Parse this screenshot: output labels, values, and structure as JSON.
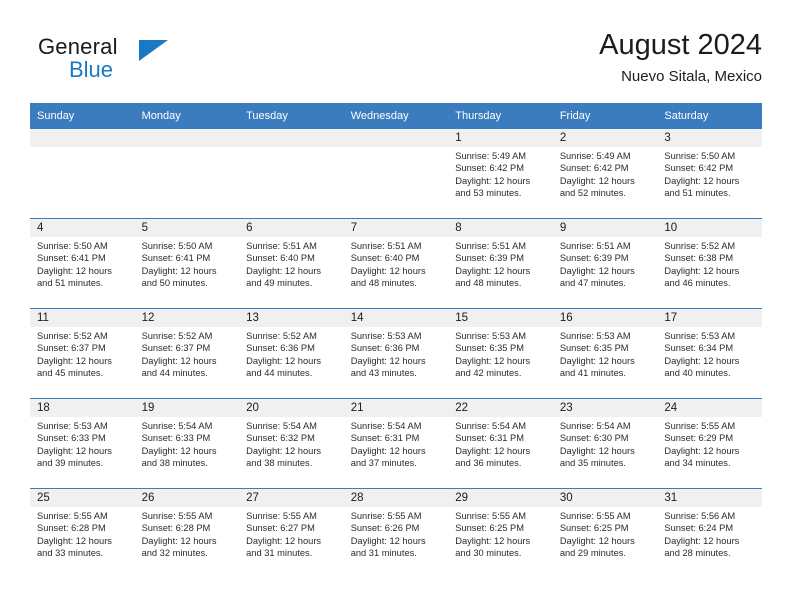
{
  "brand": {
    "word_one": "General",
    "word_two": "Blue",
    "flag_icon": "blue-triangle-flag-icon"
  },
  "header": {
    "month_title": "August 2024",
    "location": "Nuevo Sitala, Mexico"
  },
  "colors": {
    "header_blue": "#3a7cbe",
    "brand_blue": "#1b79c4",
    "day_band_gray": "#f0f0f0",
    "text": "#1c1c1c"
  },
  "calendar": {
    "weekday_headers": [
      "Sunday",
      "Monday",
      "Tuesday",
      "Wednesday",
      "Thursday",
      "Friday",
      "Saturday"
    ],
    "labels": {
      "sunrise": "Sunrise:",
      "sunset": "Sunset:",
      "daylight": "Daylight:"
    },
    "weeks": [
      [
        {
          "day": "",
          "lines": []
        },
        {
          "day": "",
          "lines": []
        },
        {
          "day": "",
          "lines": []
        },
        {
          "day": "",
          "lines": []
        },
        {
          "day": "1",
          "lines": [
            "Sunrise: 5:49 AM",
            "Sunset: 6:42 PM",
            "Daylight: 12 hours",
            "and 53 minutes."
          ]
        },
        {
          "day": "2",
          "lines": [
            "Sunrise: 5:49 AM",
            "Sunset: 6:42 PM",
            "Daylight: 12 hours",
            "and 52 minutes."
          ]
        },
        {
          "day": "3",
          "lines": [
            "Sunrise: 5:50 AM",
            "Sunset: 6:42 PM",
            "Daylight: 12 hours",
            "and 51 minutes."
          ]
        }
      ],
      [
        {
          "day": "4",
          "lines": [
            "Sunrise: 5:50 AM",
            "Sunset: 6:41 PM",
            "Daylight: 12 hours",
            "and 51 minutes."
          ]
        },
        {
          "day": "5",
          "lines": [
            "Sunrise: 5:50 AM",
            "Sunset: 6:41 PM",
            "Daylight: 12 hours",
            "and 50 minutes."
          ]
        },
        {
          "day": "6",
          "lines": [
            "Sunrise: 5:51 AM",
            "Sunset: 6:40 PM",
            "Daylight: 12 hours",
            "and 49 minutes."
          ]
        },
        {
          "day": "7",
          "lines": [
            "Sunrise: 5:51 AM",
            "Sunset: 6:40 PM",
            "Daylight: 12 hours",
            "and 48 minutes."
          ]
        },
        {
          "day": "8",
          "lines": [
            "Sunrise: 5:51 AM",
            "Sunset: 6:39 PM",
            "Daylight: 12 hours",
            "and 48 minutes."
          ]
        },
        {
          "day": "9",
          "lines": [
            "Sunrise: 5:51 AM",
            "Sunset: 6:39 PM",
            "Daylight: 12 hours",
            "and 47 minutes."
          ]
        },
        {
          "day": "10",
          "lines": [
            "Sunrise: 5:52 AM",
            "Sunset: 6:38 PM",
            "Daylight: 12 hours",
            "and 46 minutes."
          ]
        }
      ],
      [
        {
          "day": "11",
          "lines": [
            "Sunrise: 5:52 AM",
            "Sunset: 6:37 PM",
            "Daylight: 12 hours",
            "and 45 minutes."
          ]
        },
        {
          "day": "12",
          "lines": [
            "Sunrise: 5:52 AM",
            "Sunset: 6:37 PM",
            "Daylight: 12 hours",
            "and 44 minutes."
          ]
        },
        {
          "day": "13",
          "lines": [
            "Sunrise: 5:52 AM",
            "Sunset: 6:36 PM",
            "Daylight: 12 hours",
            "and 44 minutes."
          ]
        },
        {
          "day": "14",
          "lines": [
            "Sunrise: 5:53 AM",
            "Sunset: 6:36 PM",
            "Daylight: 12 hours",
            "and 43 minutes."
          ]
        },
        {
          "day": "15",
          "lines": [
            "Sunrise: 5:53 AM",
            "Sunset: 6:35 PM",
            "Daylight: 12 hours",
            "and 42 minutes."
          ]
        },
        {
          "day": "16",
          "lines": [
            "Sunrise: 5:53 AM",
            "Sunset: 6:35 PM",
            "Daylight: 12 hours",
            "and 41 minutes."
          ]
        },
        {
          "day": "17",
          "lines": [
            "Sunrise: 5:53 AM",
            "Sunset: 6:34 PM",
            "Daylight: 12 hours",
            "and 40 minutes."
          ]
        }
      ],
      [
        {
          "day": "18",
          "lines": [
            "Sunrise: 5:53 AM",
            "Sunset: 6:33 PM",
            "Daylight: 12 hours",
            "and 39 minutes."
          ]
        },
        {
          "day": "19",
          "lines": [
            "Sunrise: 5:54 AM",
            "Sunset: 6:33 PM",
            "Daylight: 12 hours",
            "and 38 minutes."
          ]
        },
        {
          "day": "20",
          "lines": [
            "Sunrise: 5:54 AM",
            "Sunset: 6:32 PM",
            "Daylight: 12 hours",
            "and 38 minutes."
          ]
        },
        {
          "day": "21",
          "lines": [
            "Sunrise: 5:54 AM",
            "Sunset: 6:31 PM",
            "Daylight: 12 hours",
            "and 37 minutes."
          ]
        },
        {
          "day": "22",
          "lines": [
            "Sunrise: 5:54 AM",
            "Sunset: 6:31 PM",
            "Daylight: 12 hours",
            "and 36 minutes."
          ]
        },
        {
          "day": "23",
          "lines": [
            "Sunrise: 5:54 AM",
            "Sunset: 6:30 PM",
            "Daylight: 12 hours",
            "and 35 minutes."
          ]
        },
        {
          "day": "24",
          "lines": [
            "Sunrise: 5:55 AM",
            "Sunset: 6:29 PM",
            "Daylight: 12 hours",
            "and 34 minutes."
          ]
        }
      ],
      [
        {
          "day": "25",
          "lines": [
            "Sunrise: 5:55 AM",
            "Sunset: 6:28 PM",
            "Daylight: 12 hours",
            "and 33 minutes."
          ]
        },
        {
          "day": "26",
          "lines": [
            "Sunrise: 5:55 AM",
            "Sunset: 6:28 PM",
            "Daylight: 12 hours",
            "and 32 minutes."
          ]
        },
        {
          "day": "27",
          "lines": [
            "Sunrise: 5:55 AM",
            "Sunset: 6:27 PM",
            "Daylight: 12 hours",
            "and 31 minutes."
          ]
        },
        {
          "day": "28",
          "lines": [
            "Sunrise: 5:55 AM",
            "Sunset: 6:26 PM",
            "Daylight: 12 hours",
            "and 31 minutes."
          ]
        },
        {
          "day": "29",
          "lines": [
            "Sunrise: 5:55 AM",
            "Sunset: 6:25 PM",
            "Daylight: 12 hours",
            "and 30 minutes."
          ]
        },
        {
          "day": "30",
          "lines": [
            "Sunrise: 5:55 AM",
            "Sunset: 6:25 PM",
            "Daylight: 12 hours",
            "and 29 minutes."
          ]
        },
        {
          "day": "31",
          "lines": [
            "Sunrise: 5:56 AM",
            "Sunset: 6:24 PM",
            "Daylight: 12 hours",
            "and 28 minutes."
          ]
        }
      ]
    ]
  }
}
